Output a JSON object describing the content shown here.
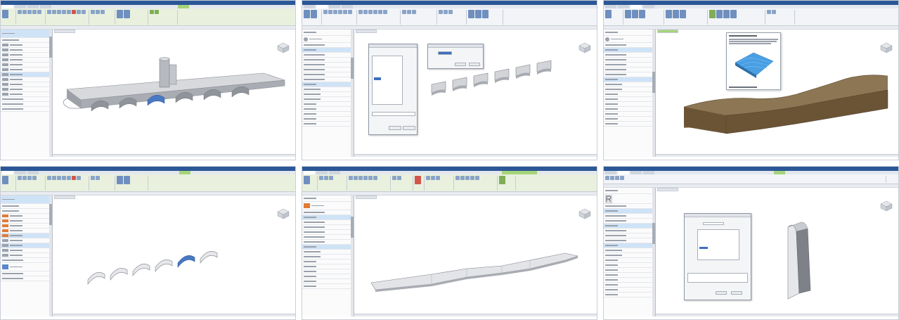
{
  "colors": {
    "titlebar": "#2b5797",
    "ribbon": "#f2f4f7",
    "ribbon_context": "#e9f1de",
    "selection": "#cfe3f7",
    "model_gray": "#c8cbd0",
    "model_blue": "#4a78c2",
    "terrain_brown": "#6b5436",
    "terrain_green_tooltip": "#4a9fe3"
  },
  "panels": [
    {
      "id": "p1",
      "ribbon_style": "green",
      "viewport_model": "arched-bridge-with-pier",
      "has_left_list": true,
      "has_dialog": false
    },
    {
      "id": "p2",
      "ribbon_style": "default",
      "viewport_model": "separated-arch-segments",
      "has_properties": true,
      "has_dialog": true
    },
    {
      "id": "p3",
      "ribbon_style": "default",
      "viewport_model": "terrain-solid",
      "has_properties": true,
      "has_tooltip": true
    },
    {
      "id": "p4",
      "ribbon_style": "green",
      "viewport_model": "arch-rings-one-selected",
      "has_left_list": true,
      "has_dialog": false
    },
    {
      "id": "p5",
      "ribbon_style": "green",
      "viewport_model": "flat-deck-slab",
      "has_properties": true,
      "has_dialog": false
    },
    {
      "id": "p6",
      "ribbon_style": "default",
      "viewport_model": "single-pier-wedge",
      "has_properties": true,
      "has_dialog": true
    }
  ],
  "icons": {
    "viewcube": "viewcube-icon",
    "app_logo": "revit-r-icon"
  }
}
